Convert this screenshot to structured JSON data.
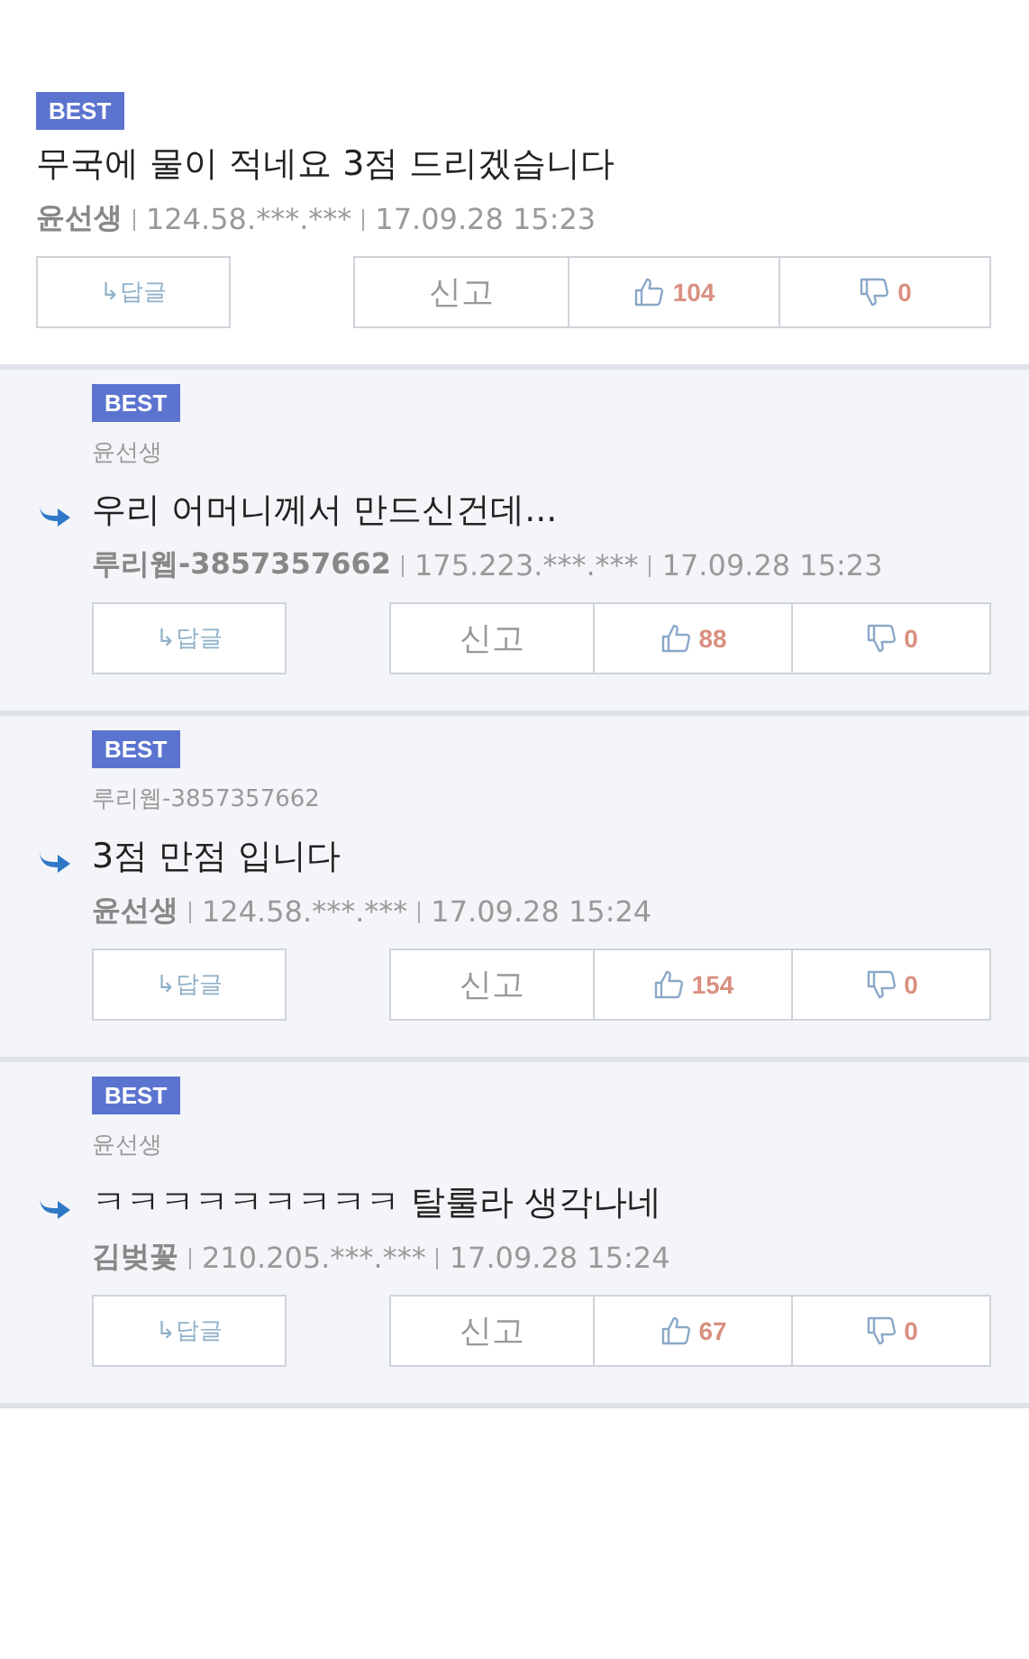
{
  "comments": [
    {
      "kind": "comment",
      "badge": "BEST",
      "text": "무국에 물이 적네요 3점 드리겠습니다",
      "author": "윤선생",
      "ip": "124.58.***.***",
      "date": "17.09.28 15:23",
      "reply_label": "↳답글",
      "report_label": "신고",
      "likes": "104",
      "dislikes": "0"
    },
    {
      "kind": "reply",
      "badge": "BEST",
      "parent": "윤선생",
      "text": "우리 어머니께서 만드신건데...",
      "author": "루리웹-3857357662",
      "ip": "175.223.***.***",
      "date": "17.09.28 15:23",
      "reply_label": "↳답글",
      "report_label": "신고",
      "likes": "88",
      "dislikes": "0"
    },
    {
      "kind": "reply",
      "badge": "BEST",
      "parent": "루리웹-3857357662",
      "text": "3점 만점 입니다",
      "author": "윤선생",
      "ip": "124.58.***.***",
      "date": "17.09.28 15:24",
      "reply_label": "↳답글",
      "report_label": "신고",
      "likes": "154",
      "dislikes": "0"
    },
    {
      "kind": "reply",
      "badge": "BEST",
      "parent": "윤선생",
      "text": "ㅋㅋㅋㅋㅋㅋㅋㅋㅋ 탈룰라 생각나네",
      "author": "김벚꽃",
      "ip": "210.205.***.***",
      "date": "17.09.28 15:24",
      "reply_label": "↳답글",
      "report_label": "신고",
      "likes": "67",
      "dislikes": "0"
    }
  ]
}
